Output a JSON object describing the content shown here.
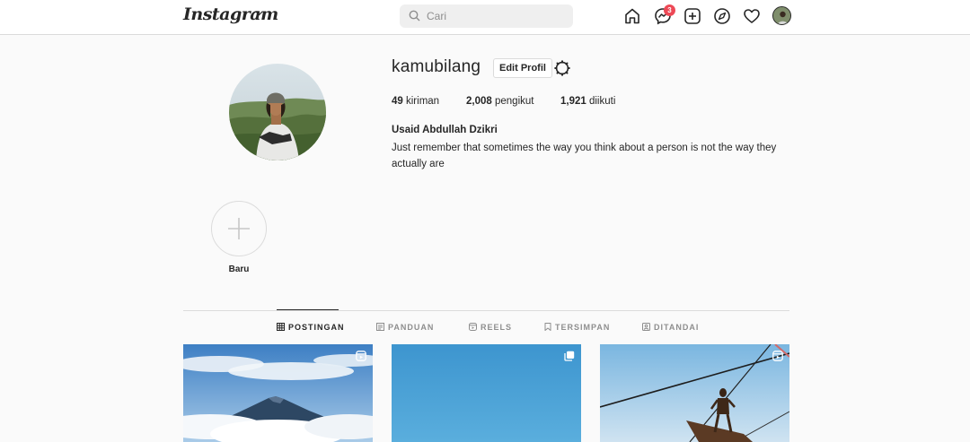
{
  "header": {
    "logo": "Instagram",
    "search": {
      "placeholder": "Cari",
      "value": ""
    },
    "notification_count": "3",
    "icons": [
      "home-icon",
      "messenger-icon",
      "new-post-icon",
      "explore-icon",
      "activity-heart-icon",
      "profile-avatar"
    ]
  },
  "profile": {
    "username": "kamubilang",
    "edit_label": "Edit Profil",
    "stats": {
      "posts_count": "49",
      "posts_label": "kiriman",
      "followers_count": "2,008",
      "followers_label": "pengikut",
      "following_count": "1,921",
      "following_label": "diikuti"
    },
    "full_name": "Usaid Abdullah Dzikri",
    "bio": "Just remember that sometimes the way you think about a person is not the way they actually are"
  },
  "highlights": [
    {
      "label": "Baru"
    }
  ],
  "tabs": [
    {
      "label": "POSTINGAN",
      "icon": "grid-icon",
      "active": true
    },
    {
      "label": "PANDUAN",
      "icon": "guide-icon",
      "active": false
    },
    {
      "label": "REELS",
      "icon": "reels-icon",
      "active": false
    },
    {
      "label": "TERSIMPAN",
      "icon": "bookmark-icon",
      "active": false
    },
    {
      "label": "DITANDAI",
      "icon": "tagged-icon",
      "active": false
    }
  ],
  "posts": [
    {
      "type": "reel",
      "icon": "reels-icon"
    },
    {
      "type": "carousel",
      "icon": "carousel-icon"
    },
    {
      "type": "reel",
      "icon": "reels-icon"
    }
  ],
  "colors": {
    "accent_border": "#dbdbdb",
    "badge": "#ed4956",
    "text": "#262626",
    "muted": "#8e8e8e"
  }
}
